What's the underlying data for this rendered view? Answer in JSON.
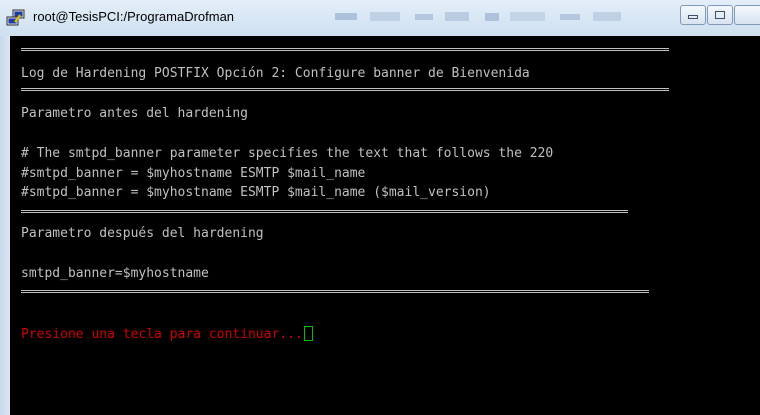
{
  "window": {
    "title": "root@TesisPCI:/ProgramaDrofman"
  },
  "terminal": {
    "header": "Log de Hardening POSTFIX Opción 2: Configure banner de Bienvenida",
    "before_label": "Parametro antes del hardening",
    "before_lines": [
      "# The smtpd_banner parameter specifies the text that follows the 220",
      "#smtpd_banner = $myhostname ESMTP $mail_name",
      "#smtpd_banner = $myhostname ESMTP $mail_name ($mail_version)"
    ],
    "after_label": "Parametro después del hardening",
    "after_line": "smtpd_banner=$myhostname",
    "prompt": "Presione una tecla para continuar...",
    "prompt_color": "#d00000",
    "cursor_color": "#00c000"
  }
}
